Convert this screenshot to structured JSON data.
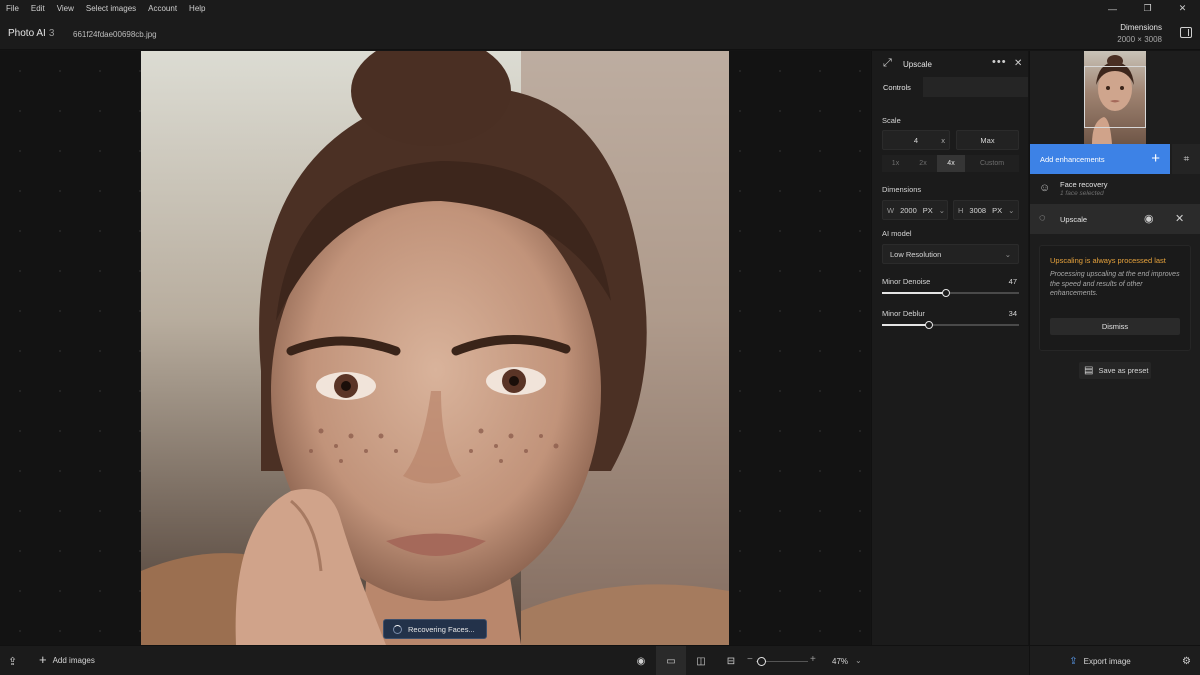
{
  "menu": [
    "File",
    "Edit",
    "View",
    "Select images",
    "Account",
    "Help"
  ],
  "window_controls": {
    "minimize": "—",
    "restore": "❐",
    "close": "✕"
  },
  "app": {
    "name": "Photo AI",
    "version": "3"
  },
  "file": {
    "name": "661f24fdae00698cb.jpg"
  },
  "dimensions": {
    "label": "Dimensions",
    "value": "2000 × 3008"
  },
  "canvas": {
    "status": "Recovering Faces..."
  },
  "bottom": {
    "add_images": "Add images",
    "zoom": "47%"
  },
  "upscale_panel": {
    "title": "Upscale",
    "tab_controls": "Controls",
    "scale_label": "Scale",
    "scale_value": "4",
    "scale_unit": "x",
    "max_label": "Max",
    "scale_options": [
      "1x",
      "2x",
      "4x",
      "Custom"
    ],
    "scale_selected": "4x",
    "dimensions_label": "Dimensions",
    "width_prefix": "W",
    "width_value": "2000",
    "width_unit": "PX",
    "height_prefix": "H",
    "height_value": "3008",
    "height_unit": "PX",
    "ai_model_label": "AI model",
    "ai_model_value": "Low Resolution",
    "denoise_label": "Minor Denoise",
    "denoise_value": 47,
    "deblur_label": "Minor Deblur",
    "deblur_value": 34
  },
  "right_panel": {
    "add_enhancements": "Add enhancements",
    "enhancements": [
      {
        "name": "Face recovery",
        "sub": "1 face selected",
        "icon": "face-icon"
      },
      {
        "name": "Upscale",
        "icon": "upscale-icon"
      }
    ],
    "notice": {
      "title": "Upscaling is always processed last",
      "body": "Processing upscaling at the end improves the speed and results of other enhancements.",
      "dismiss": "Dismiss"
    },
    "save_preset": "Save as preset",
    "export": "Export image"
  },
  "colors": {
    "accent": "#3d82e6",
    "warning": "#e6a23c",
    "toast": "#23324a"
  }
}
